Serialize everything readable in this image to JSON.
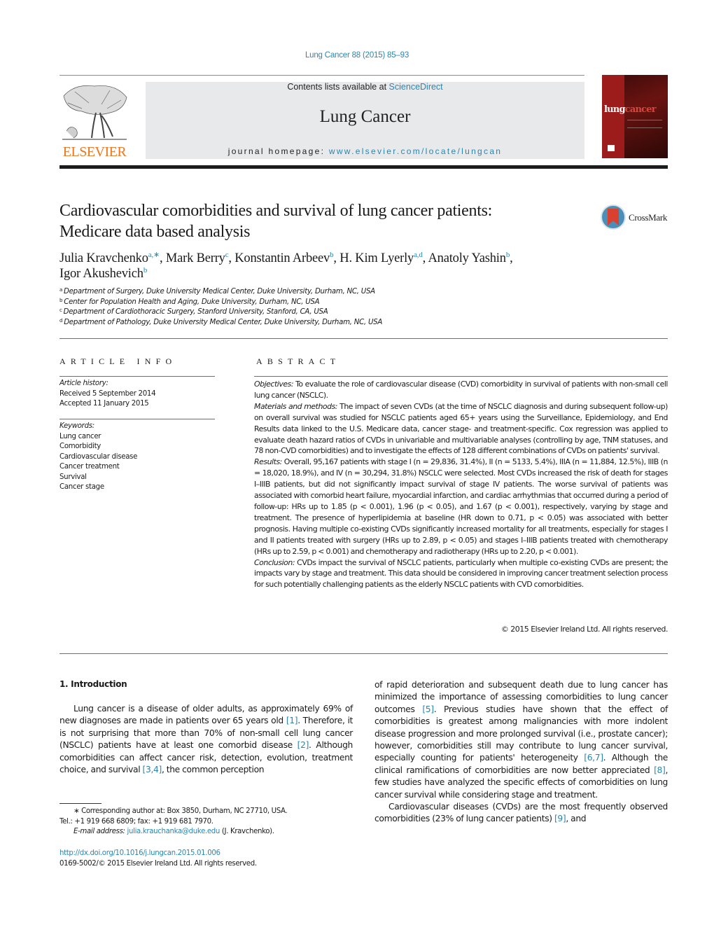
{
  "header": {
    "citation": "Lung Cancer 88 (2015) 85–93",
    "publisher_logo_word": "ELSEVIER",
    "contents_prefix": "Contents lists available at ",
    "contents_link": "ScienceDirect",
    "journal_title": "Lung Cancer",
    "homepage_prefix": "journal homepage: ",
    "homepage_link": "www.elsevier.com/locate/lungcan",
    "cover_word_part1": "lung",
    "cover_word_part2": "cancer",
    "colors": {
      "link": "#2a86b0",
      "elsevier_orange": "#e87722",
      "cover_red": "#9c1b1b"
    }
  },
  "article": {
    "title_line1": "Cardiovascular comorbidities and survival of lung cancer patients:",
    "title_line2": "Medicare data based analysis",
    "crossmark_label": "CrossMark",
    "authors": [
      {
        "name": "Julia Kravchenko",
        "sup": "a,∗",
        "sep": ", "
      },
      {
        "name": "Mark Berry",
        "sup": "c",
        "sep": ", "
      },
      {
        "name": "Konstantin Arbeev",
        "sup": "b",
        "sep": ", "
      },
      {
        "name": "H. Kim Lyerly",
        "sup": "a,d",
        "sep": ", "
      },
      {
        "name": "Anatoly Yashin",
        "sup": "b",
        "sep": ","
      },
      {
        "name": "Igor Akushevich",
        "sup": "b",
        "sep": ""
      }
    ],
    "affiliations": [
      {
        "key": "a",
        "text": "Department of Surgery, Duke University Medical Center, Duke University, Durham, NC, USA"
      },
      {
        "key": "b",
        "text": "Center for Population Health and Aging, Duke University, Durham, NC, USA"
      },
      {
        "key": "c",
        "text": "Department of Cardiothoracic Surgery, Stanford University, Stanford, CA, USA"
      },
      {
        "key": "d",
        "text": "Department of Pathology, Duke University Medical Center, Duke University, Durham, NC, USA"
      }
    ]
  },
  "article_info": {
    "heading": "ARTICLE INFO",
    "history_label": "Article history:",
    "received": "Received 5 September 2014",
    "accepted": "Accepted 11 January 2015",
    "keywords_label": "Keywords:",
    "keywords": [
      "Lung cancer",
      "Comorbidity",
      "Cardiovascular disease",
      "Cancer treatment",
      "Survival",
      "Cancer stage"
    ]
  },
  "abstract": {
    "heading": "ABSTRACT",
    "sections": [
      {
        "label": "Objectives:",
        "text": " To evaluate the role of cardiovascular disease (CVD) comorbidity in survival of patients with non-small cell lung cancer (NSCLC)."
      },
      {
        "label": "Materials and methods:",
        "text": " The impact of seven CVDs (at the time of NSCLC diagnosis and during subsequent follow-up) on overall survival was studied for NSCLC patients aged 65+ years using the Surveillance, Epidemiology, and End Results data linked to the U.S. Medicare data, cancer stage- and treatment-specific. Cox regression was applied to evaluate death hazard ratios of CVDs in univariable and multivariable analyses (controlling by age, TNM statuses, and 78 non-CVD comorbidities) and to investigate the effects of 128 different combinations of CVDs on patients' survival."
      },
      {
        "label": "Results:",
        "text": " Overall, 95,167 patients with stage I (n = 29,836, 31.4%), II (n = 5133, 5.4%), IIIA (n = 11,884, 12.5%), IIIB (n = 18,020, 18.9%), and IV (n = 30,294, 31.8%) NSCLC were selected. Most CVDs increased the risk of death for stages I–IIIB patients, but did not significantly impact survival of stage IV patients. The worse survival of patients was associated with comorbid heart failure, myocardial infarction, and cardiac arrhythmias that occurred during a period of follow-up: HRs up to 1.85 (p < 0.001), 1.96 (p < 0.05), and 1.67 (p < 0.001), respectively, varying by stage and treatment. The presence of hyperlipidemia at baseline (HR down to 0.71, p < 0.05) was associated with better prognosis. Having multiple co-existing CVDs significantly increased mortality for all treatments, especially for stages I and II patients treated with surgery (HRs up to 2.89, p < 0.05) and stages I–IIIB patients treated with chemotherapy (HRs up to 2.59, p < 0.001) and chemotherapy and radiotherapy (HRs up to 2.20, p < 0.001)."
      },
      {
        "label": "Conclusion:",
        "text": " CVDs impact the survival of NSCLC patients, particularly when multiple co-existing CVDs are present; the impacts vary by stage and treatment. This data should be considered in improving cancer treatment selection process for such potentially challenging patients as the elderly NSCLC patients with CVD comorbidities."
      }
    ],
    "copyright": "© 2015 Elsevier Ireland Ltd. All rights reserved."
  },
  "body": {
    "intro_heading": "1.  Introduction",
    "left_para": [
      {
        "t": "Lung cancer is a disease of older adults, as approximately 69% of new diagnoses are made in patients over 65 years old "
      },
      {
        "ref": "[1]"
      },
      {
        "t": ". Therefore, it is not surprising that more than 70% of non-small cell lung cancer (NSCLC) patients have at least one comorbid disease "
      },
      {
        "ref": "[2]"
      },
      {
        "t": ". Although comorbidities can affect cancer risk, detection, evolution, treatment choice, and survival "
      },
      {
        "ref": "[3,4]"
      },
      {
        "t": ", the common perception"
      }
    ],
    "right_para1": [
      {
        "t": "of rapid deterioration and subsequent death due to lung cancer has minimized the importance of assessing comorbidities to lung cancer outcomes "
      },
      {
        "ref": "[5]"
      },
      {
        "t": ". Previous studies have shown that the effect of comorbidities is greatest among malignancies with more indolent disease progression and more prolonged survival (i.e., prostate cancer); however, comorbidities still may contribute to lung cancer survival, especially counting for patients' heterogeneity "
      },
      {
        "ref": "[6,7]"
      },
      {
        "t": ". Although the clinical ramifications of comorbidities are now better appreciated "
      },
      {
        "ref": "[8]"
      },
      {
        "t": ", few studies have analyzed the specific effects of comorbidities on lung cancer survival while considering stage and treatment."
      }
    ],
    "right_para2": [
      {
        "t": "Cardiovascular diseases (CVDs) are the most frequently observed comorbidities (23% of lung cancer patients) "
      },
      {
        "ref": "[9]"
      },
      {
        "t": ", and"
      }
    ]
  },
  "footnotes": {
    "corresponding": "∗  Corresponding author at: Box 3850, Durham, NC 27710, USA.",
    "tel": "Tel.: +1 919 668 6809; fax: +1 919 681 7970.",
    "email_label": "E-mail address:",
    "email": "julia.krauchanka@duke.edu",
    "email_suffix": " (J. Kravchenko).",
    "doi": "http://dx.doi.org/10.1016/j.lungcan.2015.01.006",
    "issn_copyright": "0169-5002/© 2015 Elsevier Ireland Ltd. All rights reserved."
  }
}
